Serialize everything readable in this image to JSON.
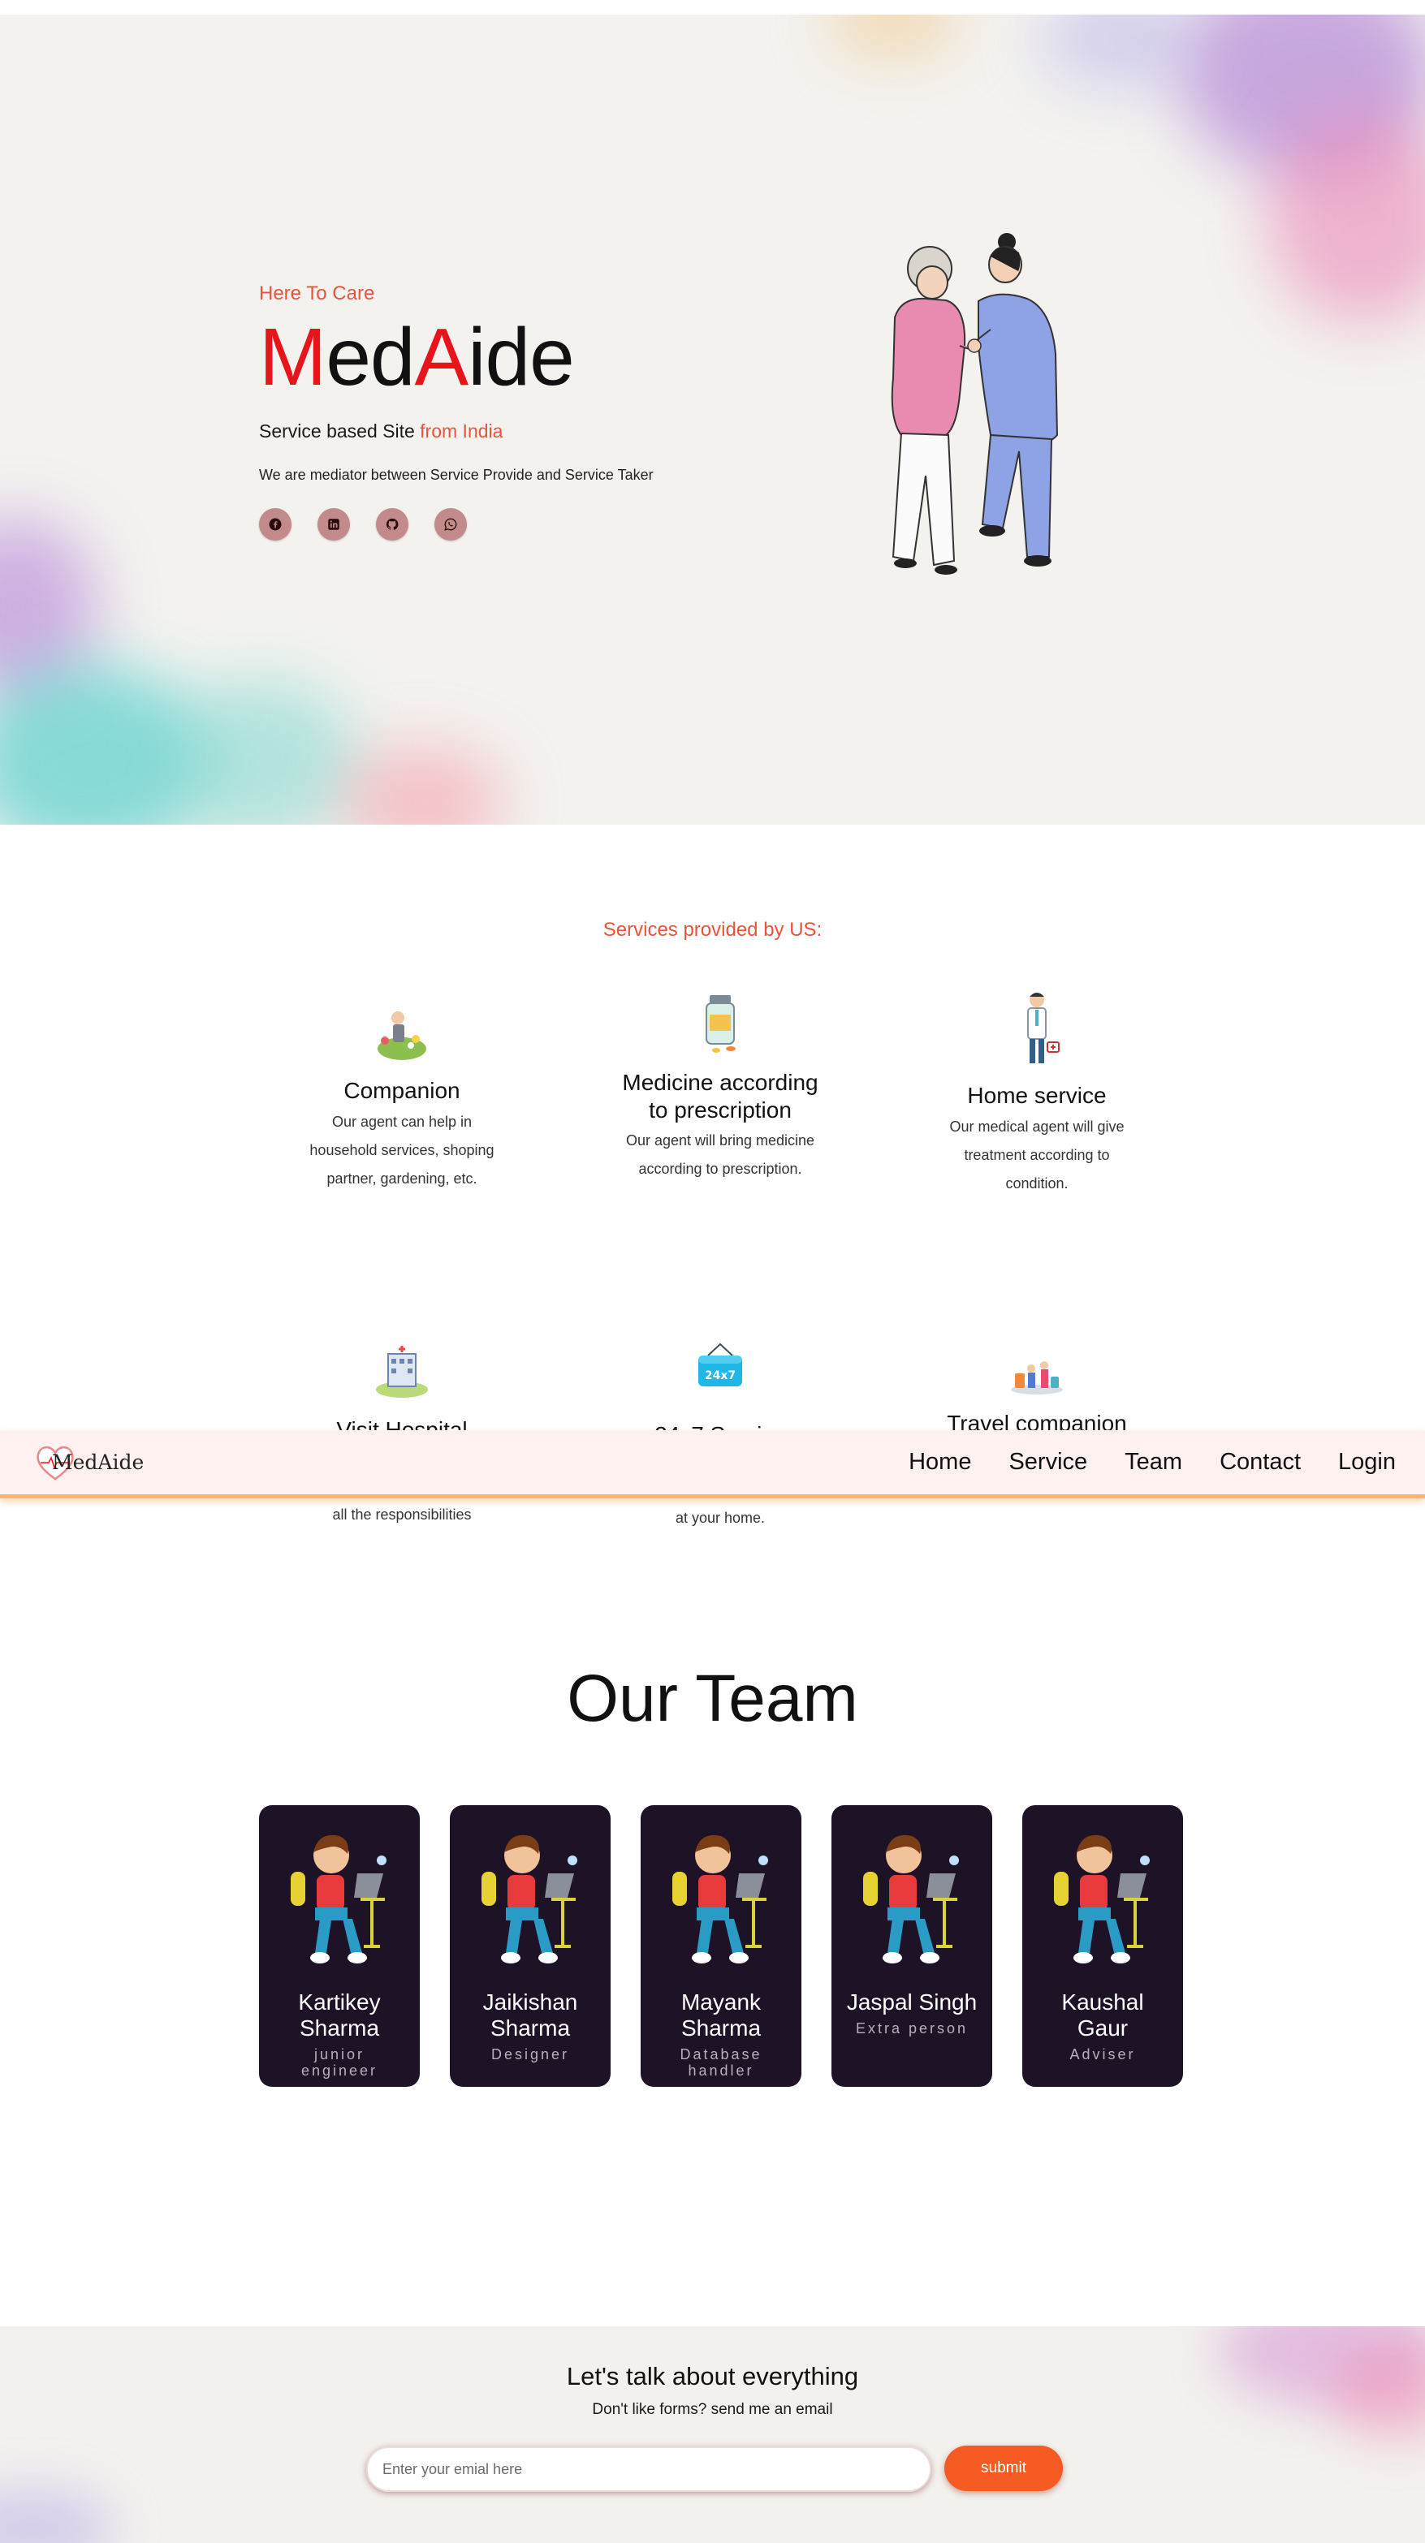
{
  "hero": {
    "tagline": "Here To Care",
    "brand": {
      "m": "M",
      "ed": "ed",
      "a": "A",
      "ide": "ide"
    },
    "subtitle": {
      "main": "Service based Site ",
      "accent": "from India"
    },
    "description": "We are mediator between Service Provide and Service Taker",
    "socials": [
      "facebook-icon",
      "linkedin-icon",
      "github-icon",
      "whatsapp-icon"
    ]
  },
  "services": {
    "title": "Services provided by US:",
    "items": [
      {
        "title": "Companion",
        "text": "Our agent can help in household services, shoping partner, gardening, etc."
      },
      {
        "title": "Medicine according to prescription",
        "text": "Our agent will bring medicine according to prescription."
      },
      {
        "title": "Home service",
        "text": "Our medical agent will give treatment according to condition."
      },
      {
        "title": "Visit Hospital",
        "text": "all the responsibilities"
      },
      {
        "title": "24x7 Service",
        "text": "at your home.",
        "badge": "24x7"
      },
      {
        "title": "Travel companion",
        "text": ""
      }
    ]
  },
  "navbar": {
    "logo": "MedAide",
    "links": [
      "Home",
      "Service",
      "Team",
      "Contact",
      "Login"
    ]
  },
  "team": {
    "title": "Our Team",
    "members": [
      {
        "name": "Kartikey Sharma",
        "role": "junior engineer"
      },
      {
        "name": "Jaikishan Sharma",
        "role": "Designer"
      },
      {
        "name": "Mayank Sharma",
        "role": "Database handler"
      },
      {
        "name": "Jaspal Singh",
        "role": "Extra person"
      },
      {
        "name": "Kaushal Gaur",
        "role": "Adviser"
      }
    ]
  },
  "contact": {
    "title": "Let's talk about everything",
    "subtitle": "Don't like forms? send me an email",
    "email_placeholder": "Enter your emial here",
    "submit_label": "submit"
  },
  "colors": {
    "accent": "#e8543a",
    "brand_red": "#e8141b",
    "card_bg": "#1e1226",
    "submit": "#f55a22",
    "nav_bg": "#fff1f0"
  }
}
